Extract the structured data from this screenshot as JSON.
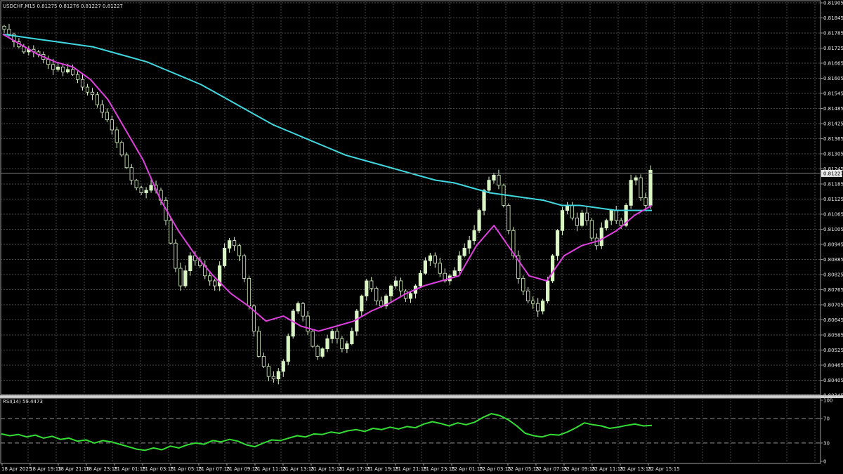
{
  "chart_data": [
    {
      "type": "candlestick",
      "title": "USDCHF,M15  0.81275 0.81276 0.81227 0.81227",
      "symbol": "USDCHF",
      "timeframe": "M15",
      "last_bar": {
        "open": 0.81275,
        "high": 0.81276,
        "low": 0.81227,
        "close": 0.81227
      },
      "current_price": 0.81227,
      "current_price_label": "0.81227",
      "ylim": [
        0.80345,
        0.81905
      ],
      "y_ticks": [
        "0.81905",
        "0.81845",
        "0.81785",
        "0.81725",
        "0.81665",
        "0.81605",
        "0.81545",
        "0.81485",
        "0.81425",
        "0.81365",
        "0.81305",
        "0.81245",
        "0.81185",
        "0.81125",
        "0.81065",
        "0.81005",
        "0.80945",
        "0.80885",
        "0.80825",
        "0.80765",
        "0.80705",
        "0.80645",
        "0.80585",
        "0.80525",
        "0.80465",
        "0.80405",
        "0.80345"
      ],
      "grid": true,
      "close_series": [
        0.818,
        0.8178,
        0.8175,
        0.8173,
        0.8171,
        0.8172,
        0.8171,
        0.817,
        0.8168,
        0.8166,
        0.8164,
        0.8165,
        0.8163,
        0.8164,
        0.8162,
        0.816,
        0.8157,
        0.8155,
        0.8154,
        0.815,
        0.8147,
        0.8144,
        0.814,
        0.8135,
        0.813,
        0.8125,
        0.812,
        0.8117,
        0.8115,
        0.8116,
        0.8118,
        0.8116,
        0.8112,
        0.8104,
        0.8095,
        0.8085,
        0.8078,
        0.8084,
        0.809,
        0.8088,
        0.8086,
        0.8082,
        0.808,
        0.8078,
        0.8086,
        0.8093,
        0.8096,
        0.8094,
        0.809,
        0.8081,
        0.807,
        0.806,
        0.805,
        0.8046,
        0.8042,
        0.8041,
        0.8044,
        0.8048,
        0.8058,
        0.8068,
        0.8071,
        0.8066,
        0.806,
        0.8054,
        0.805,
        0.8053,
        0.8057,
        0.806,
        0.8057,
        0.8053,
        0.8055,
        0.806,
        0.8068,
        0.8074,
        0.808,
        0.8077,
        0.8072,
        0.807,
        0.8074,
        0.8078,
        0.808,
        0.8076,
        0.8073,
        0.8075,
        0.8078,
        0.8083,
        0.8088,
        0.809,
        0.8087,
        0.8083,
        0.808,
        0.8082,
        0.8084,
        0.809,
        0.8093,
        0.8096,
        0.81,
        0.8108,
        0.8116,
        0.812,
        0.8122,
        0.8118,
        0.811,
        0.81,
        0.809,
        0.8081,
        0.8076,
        0.8072,
        0.8071,
        0.8068,
        0.8072,
        0.808,
        0.809,
        0.81,
        0.8108,
        0.811,
        0.8105,
        0.8102,
        0.8107,
        0.8104,
        0.8097,
        0.8094,
        0.8101,
        0.8104,
        0.8108,
        0.8104,
        0.8102,
        0.811,
        0.812,
        0.8121,
        0.8113,
        0.811,
        0.8124
      ],
      "series": [
        {
          "name": "MA long (cyan)",
          "color": "#40d8e0",
          "values": [
            0.8178,
            0.8177,
            0.8176,
            0.8175,
            0.8174,
            0.8173,
            0.8171,
            0.8169,
            0.8167,
            0.8164,
            0.8161,
            0.8158,
            0.8154,
            0.815,
            0.8146,
            0.8142,
            0.8139,
            0.8136,
            0.8133,
            0.813,
            0.8128,
            0.8126,
            0.8124,
            0.8122,
            0.812,
            0.8119,
            0.8117,
            0.8115,
            0.8114,
            0.8113,
            0.8112,
            0.811,
            0.811,
            0.8109,
            0.8108,
            0.8108,
            0.8108
          ]
        },
        {
          "name": "MA short (magenta)",
          "color": "#e040e0",
          "values": [
            0.8178,
            0.8174,
            0.817,
            0.8167,
            0.8165,
            0.816,
            0.8152,
            0.814,
            0.8128,
            0.8112,
            0.81,
            0.809,
            0.8082,
            0.8075,
            0.807,
            0.8064,
            0.8066,
            0.8062,
            0.806,
            0.8062,
            0.8064,
            0.8068,
            0.8071,
            0.8075,
            0.8078,
            0.808,
            0.8082,
            0.8094,
            0.8102,
            0.8092,
            0.8082,
            0.808,
            0.809,
            0.8094,
            0.8096,
            0.81,
            0.8106,
            0.811
          ]
        }
      ]
    },
    {
      "type": "line",
      "title": "RSI(14) 59.4473",
      "ylim": [
        0,
        100
      ],
      "y_ticks": [
        "100",
        "70",
        "30",
        "0"
      ],
      "levels": [
        70,
        30
      ],
      "series": [
        {
          "name": "RSI(14)",
          "color": "#33dd33",
          "values": [
            45,
            42,
            44,
            40,
            43,
            38,
            41,
            36,
            38,
            33,
            35,
            30,
            34,
            32,
            28,
            24,
            20,
            18,
            22,
            19,
            25,
            22,
            27,
            30,
            28,
            34,
            32,
            36,
            33,
            27,
            24,
            30,
            35,
            34,
            38,
            42,
            40,
            45,
            44,
            48,
            46,
            50,
            52,
            49,
            54,
            52,
            56,
            53,
            57,
            55,
            61,
            65,
            62,
            58,
            63,
            60,
            64,
            72,
            78,
            75,
            68,
            58,
            46,
            42,
            40,
            44,
            43,
            48,
            55,
            63,
            60,
            58,
            54,
            56,
            59,
            61,
            58,
            59
          ]
        }
      ],
      "x_ticks": [
        "18 Apr 2025",
        "18 Apr 19:15",
        "18 Apr 21:15",
        "18 Apr 23:15",
        "21 Apr 01:15",
        "21 Apr 03:15",
        "21 Apr 05:15",
        "21 Apr 07:15",
        "21 Apr 09:15",
        "21 Apr 11:15",
        "21 Apr 13:15",
        "21 Apr 15:15",
        "21 Apr 17:15",
        "21 Apr 19:15",
        "21 Apr 21:15",
        "21 Apr 23:15",
        "22 Apr 01:15",
        "22 Apr 03:15",
        "22 Apr 05:15",
        "22 Apr 07:15",
        "22 Apr 09:15",
        "22 Apr 11:15",
        "22 Apr 13:15",
        "22 Apr 15:15"
      ]
    }
  ],
  "colors": {
    "background": "#000000",
    "grid": "#4a4a4a",
    "frame": "#a0a0a0",
    "text": "#e6e6e6",
    "bull_candle": "#d9f5c4",
    "bear_candle": "#000000",
    "wick": "#d9f5c4",
    "price_line": "#7a7a7a",
    "price_tag_bg": "#e6e6e6"
  }
}
